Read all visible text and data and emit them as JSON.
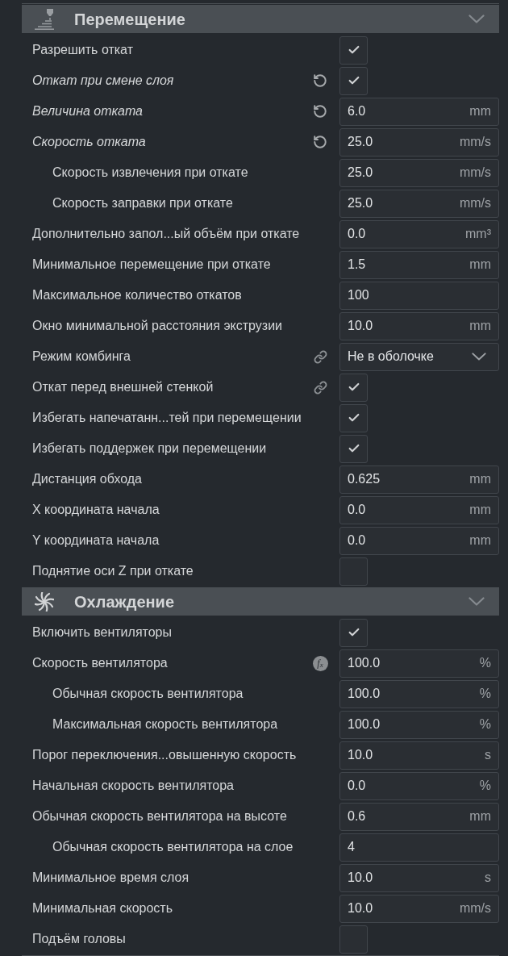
{
  "sections": [
    {
      "title": "Перемещение",
      "kind": "travel",
      "expanded": true,
      "settings": [
        {
          "label": "Разрешить откат",
          "kind": "checkbox",
          "checked": true,
          "modified": false,
          "linked": false
        },
        {
          "label": "Откат при смене слоя",
          "kind": "checkbox",
          "checked": true,
          "modified": true,
          "linked": false
        },
        {
          "label": "Величина отката",
          "kind": "number",
          "value": "6.0",
          "unit": "mm",
          "modified": true,
          "linked": false
        },
        {
          "label": "Скорость отката",
          "kind": "number",
          "value": "25.0",
          "unit": "mm/s",
          "modified": true,
          "linked": false,
          "children": [
            {
              "label": "Скорость извлечения при откате",
              "kind": "number",
              "value": "25.0",
              "unit": "mm/s",
              "modified": false,
              "linked": false
            },
            {
              "label": "Скорость заправки при откате",
              "kind": "number",
              "value": "25.0",
              "unit": "mm/s",
              "modified": false,
              "linked": false
            }
          ]
        },
        {
          "label": "Дополнительно запол...ый объём при откате",
          "kind": "number",
          "value": "0.0",
          "unit": "mm³",
          "modified": false,
          "linked": false
        },
        {
          "label": "Минимальное перемещение при откате",
          "kind": "number",
          "value": "1.5",
          "unit": "mm",
          "modified": false,
          "linked": false
        },
        {
          "label": "Максимальное количество откатов",
          "kind": "number",
          "value": "100",
          "modified": false,
          "linked": false
        },
        {
          "label": "Окно минимальной расстояния экструзии",
          "kind": "number",
          "value": "10.0",
          "unit": "mm",
          "modified": false,
          "linked": false
        },
        {
          "label": "Режим комбинга",
          "kind": "dropdown",
          "value": "Не в оболочке",
          "modified": false,
          "linked": true
        },
        {
          "label": "Откат перед внешней стенкой",
          "kind": "checkbox",
          "checked": true,
          "modified": false,
          "linked": true
        },
        {
          "label": "Избегать напечатанн...тей при перемещении",
          "kind": "checkbox",
          "checked": true,
          "modified": false,
          "linked": false
        },
        {
          "label": "Избегать поддержек при перемещении",
          "kind": "checkbox",
          "checked": true,
          "modified": false,
          "linked": false
        },
        {
          "label": "Дистанция обхода",
          "kind": "number",
          "value": "0.625",
          "unit": "mm",
          "modified": false,
          "linked": false
        },
        {
          "label": "X координата начала",
          "kind": "number",
          "value": "0.0",
          "unit": "mm",
          "modified": false,
          "linked": false
        },
        {
          "label": "Y координата начала",
          "kind": "number",
          "value": "0.0",
          "unit": "mm",
          "modified": false,
          "linked": false
        },
        {
          "label": "Поднятие оси Z при откате",
          "kind": "checkbox",
          "checked": false,
          "modified": false,
          "linked": false
        }
      ]
    },
    {
      "title": "Охлаждение",
      "kind": "cooling",
      "expanded": true,
      "settings": [
        {
          "label": "Включить вентиляторы",
          "kind": "checkbox",
          "checked": true,
          "modified": false,
          "linked": false
        },
        {
          "label": "Скорость вентилятора",
          "kind": "number",
          "value": "100.0",
          "unit": "%",
          "modified": false,
          "linked": false,
          "formula": "f$_{x}$",
          "children": [
            {
              "label": "Обычная скорость вентилятора",
              "kind": "number",
              "value": "100.0",
              "unit": "%",
              "modified": false,
              "linked": false
            },
            {
              "label": "Максимальная скорость вентилятора",
              "kind": "number",
              "value": "100.0",
              "unit": "%",
              "modified": false,
              "linked": false
            }
          ]
        },
        {
          "label": "Порог переключения...овышенную скорость",
          "kind": "number",
          "value": "10.0",
          "unit": "s",
          "modified": false,
          "linked": false
        },
        {
          "label": "Начальная скорость вентилятора",
          "kind": "number",
          "value": "0.0",
          "unit": "%",
          "modified": false,
          "linked": false
        },
        {
          "label": "Обычная скорость вентилятора на высоте",
          "kind": "number",
          "value": "0.6",
          "unit": "mm",
          "modified": false,
          "linked": false,
          "children": [
            {
              "label": "Обычная скорость вентилятора на слое",
              "kind": "number",
              "value": "4",
              "modified": false,
              "linked": false
            }
          ]
        },
        {
          "label": "Минимальное время слоя",
          "kind": "number",
          "value": "10.0",
          "unit": "s",
          "modified": false,
          "linked": false
        },
        {
          "label": "Минимальная скорость",
          "kind": "number",
          "value": "10.0",
          "unit": "mm/s",
          "modified": false,
          "linked": false
        },
        {
          "label": "Подъём головы",
          "kind": "checkbox",
          "checked": false,
          "modified": false,
          "linked": false
        }
      ]
    }
  ]
}
